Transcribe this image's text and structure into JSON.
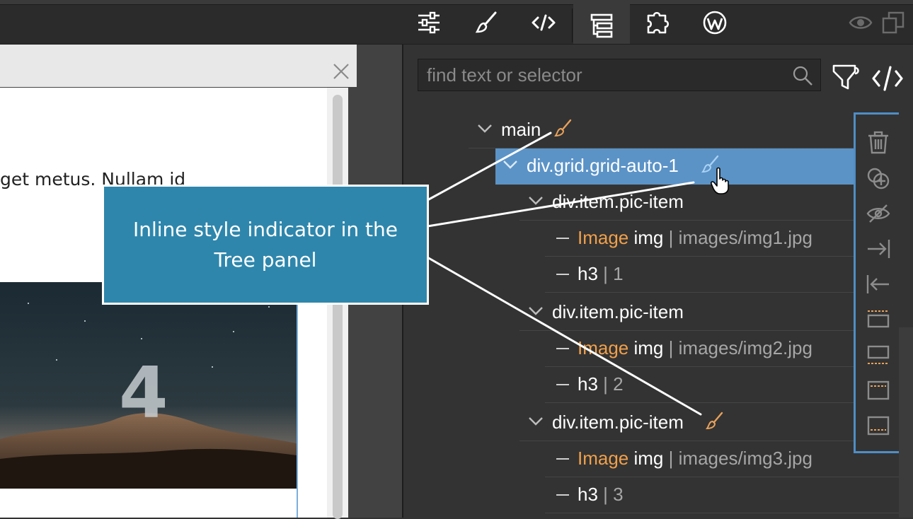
{
  "toolbar": {
    "icons": [
      "sliders-icon",
      "brush-icon",
      "code-icon",
      "tree-icon",
      "puzzle-icon",
      "wordpress-icon",
      "eye-icon",
      "duplicate-icon"
    ],
    "active": "tree-icon"
  },
  "canvas": {
    "text_fragment": "get metus. Nullam id",
    "photo_number": "4"
  },
  "tree_panel": {
    "search": {
      "placeholder": "find text or selector",
      "value": ""
    },
    "rows": [
      {
        "indent": 0,
        "type": "element",
        "tag": "main",
        "expanded": true,
        "inline_style": true
      },
      {
        "indent": 1,
        "type": "element",
        "tag": "div.grid.grid-auto-1",
        "expanded": true,
        "inline_style": true,
        "selected": true
      },
      {
        "indent": 2,
        "type": "element",
        "tag": "div.item.pic-item",
        "expanded": true,
        "inline_style": false
      },
      {
        "indent": 3,
        "type": "leaf",
        "component": "Image",
        "tag": "img",
        "sep": "|",
        "value": "images/img1.jpg"
      },
      {
        "indent": 3,
        "type": "leaf",
        "tag": "h3",
        "sep": "|",
        "value": "1"
      },
      {
        "indent": 2,
        "type": "element",
        "tag": "div.item.pic-item",
        "expanded": true,
        "inline_style": false
      },
      {
        "indent": 3,
        "type": "leaf",
        "component": "Image",
        "tag": "img",
        "sep": "|",
        "value": "images/img2.jpg"
      },
      {
        "indent": 3,
        "type": "leaf",
        "tag": "h3",
        "sep": "|",
        "value": "2"
      },
      {
        "indent": 2,
        "type": "element",
        "tag": "div.item.pic-item",
        "expanded": true,
        "inline_style": true
      },
      {
        "indent": 3,
        "type": "leaf",
        "component": "Image",
        "tag": "img",
        "sep": "|",
        "value": "images/img3.jpg"
      },
      {
        "indent": 3,
        "type": "leaf",
        "tag": "h3",
        "sep": "|",
        "value": "3"
      }
    ],
    "actions": [
      "trash-icon",
      "add-circle-icon",
      "hide-icon",
      "indent-icon",
      "outdent-icon",
      "move-up-icon",
      "move-down-icon",
      "wrap-top-icon",
      "wrap-bottom-icon"
    ]
  },
  "callout": {
    "text": "Inline style indicator in the Tree panel"
  },
  "colors": {
    "panel_bg": "#333333",
    "selected_row": "#5b93c7",
    "callout_bg": "#2e86ac",
    "image_tag": "#f0a04b",
    "accent_border": "#4f8ec6"
  }
}
